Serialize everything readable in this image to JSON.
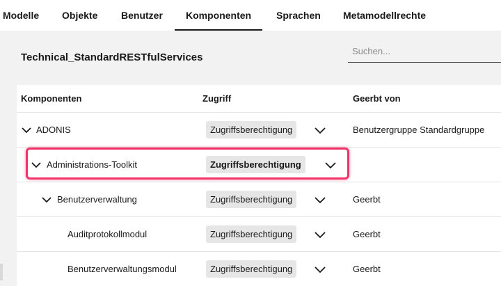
{
  "tabs": [
    {
      "label": "Modelle"
    },
    {
      "label": "Objekte"
    },
    {
      "label": "Benutzer"
    },
    {
      "label": "Komponenten",
      "active": true
    },
    {
      "label": "Sprachen"
    },
    {
      "label": "Metamodellrechte"
    }
  ],
  "panel": {
    "title": "Technical_StandardRESTfulServices",
    "search_placeholder": "Suchen..."
  },
  "table": {
    "columns": [
      "Komponenten",
      "Zugriff",
      "Geerbt von"
    ],
    "rows": [
      {
        "name": "ADONIS",
        "access": "Zugriffsberechtigung",
        "inherited": "Benutzergruppe Standardgruppe"
      },
      {
        "name": "Administrations-Toolkit",
        "access": "Zugriffsberechtigung",
        "inherited": ""
      },
      {
        "name": "Benutzerverwaltung",
        "access": "Zugriffsberechtigung",
        "inherited": "Geerbt"
      },
      {
        "name": "Auditprotokollmodul",
        "access": "Zugriffsberechtigung",
        "inherited": "Geerbt"
      },
      {
        "name": "Benutzerverwaltungsmodul",
        "access": "Zugriffsberechtigung",
        "inherited": "Geerbt"
      }
    ]
  },
  "colors": {
    "highlight": "#f0346a",
    "pill_bg": "#e6e6e6"
  },
  "icons": {
    "expand": "chevron-down-icon",
    "dropdown": "chevron-down-icon"
  }
}
